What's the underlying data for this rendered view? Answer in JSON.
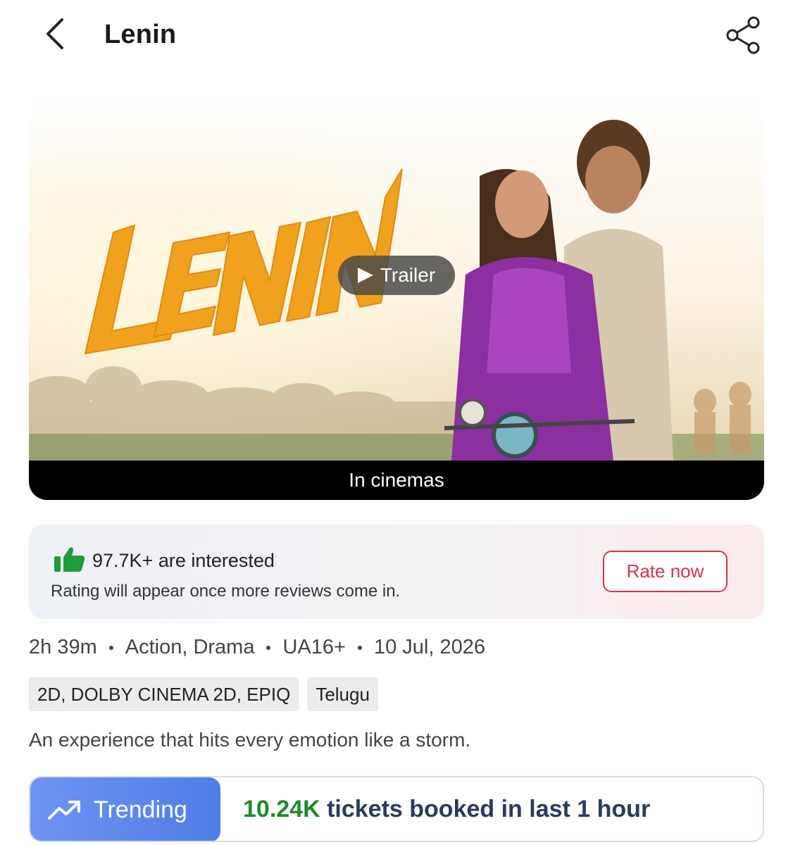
{
  "header": {
    "title": "Lenin",
    "back_icon": "chevron-left-icon",
    "share_icon": "share-icon"
  },
  "banner": {
    "poster_title": "LENIN",
    "trailer_label": "Trailer",
    "status": "In cinemas"
  },
  "interest": {
    "count_text": "97.7K+ are interested",
    "note": "Rating will appear once more reviews come in.",
    "rate_button": "Rate now",
    "thumb_icon": "thumbs-up-icon",
    "thumb_color": "#1f9d3a"
  },
  "meta": {
    "duration": "2h 39m",
    "genres": "Action, Drama",
    "certificate": "UA16+",
    "release_date": "10 Jul, 2026"
  },
  "chips": {
    "formats": "2D, DOLBY CINEMA 2D, EPIQ",
    "language": "Telugu"
  },
  "tagline": "An experience that hits every emotion like a storm.",
  "trending": {
    "label": "Trending",
    "icon": "trending-up-icon",
    "count": "10.24K",
    "text": " tickets booked in last 1 hour"
  },
  "colors": {
    "accent_red": "#d9344a",
    "trend_blue": "#5a86ec",
    "trend_green": "#1f8b2c"
  }
}
